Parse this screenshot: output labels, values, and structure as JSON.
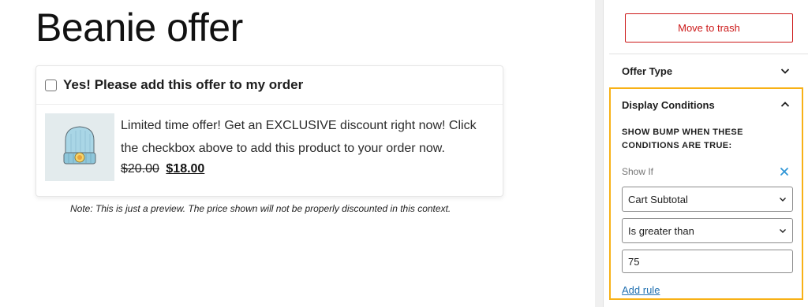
{
  "preview": {
    "title": "Beanie offer",
    "offer": {
      "checkbox_label": "Yes! Please add this offer to my order",
      "description": "Limited time offer! Get an EXCLUSIVE discount right now! Click the checkbox above to add this product to your order now.",
      "original_price": "$20.00",
      "sale_price": "$18.00",
      "checked": false
    },
    "note": "Note: This is just a preview. The price shown will not be properly discounted in this context."
  },
  "sidebar": {
    "trash_button": "Move to trash",
    "offer_type": {
      "label": "Offer Type",
      "expanded": false
    },
    "display_conditions": {
      "label": "Display Conditions",
      "expanded": true,
      "heading": "SHOW BUMP WHEN THESE CONDITIONS ARE TRUE:",
      "show_if_label": "Show If",
      "rule": {
        "field": "Cart Subtotal",
        "operator": "Is greater than",
        "value": "75"
      },
      "add_rule_link": "Add rule"
    }
  },
  "colors": {
    "danger": "#cc1818",
    "highlight": "#f8b116",
    "link": "#2271b1",
    "remove_icon": "#2f95d6"
  },
  "icons": {
    "offer_type_toggle": "chevron-down-icon",
    "display_conditions_toggle": "chevron-up-icon",
    "remove_rule": "close-icon",
    "select_arrow": "chevron-down-icon"
  }
}
